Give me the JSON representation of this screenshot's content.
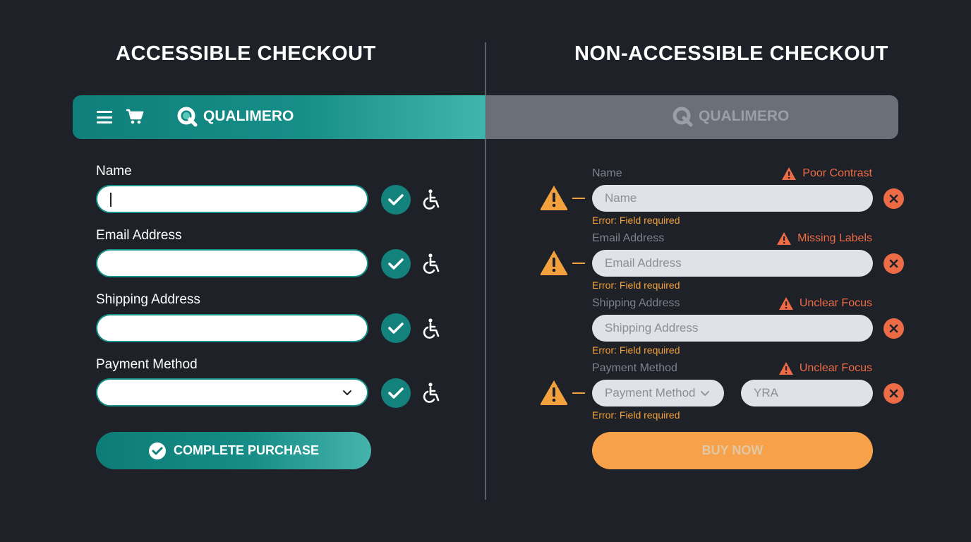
{
  "left_panel": {
    "title": "ACCESSIBLE CHECKOUT",
    "brand": "QUALIMERO",
    "fields": [
      {
        "label": "Name"
      },
      {
        "label": "Email Address"
      },
      {
        "label": "Shipping Address"
      },
      {
        "label": "Payment Method"
      }
    ],
    "submit_label": "COMPLETE PURCHASE"
  },
  "right_panel": {
    "title": "NON-ACCESSIBLE CHECKOUT",
    "brand": "QUALIMERO",
    "fields": [
      {
        "label": "Name",
        "placeholder": "Name",
        "issue": "Poor Contrast",
        "error": "Error: Field required"
      },
      {
        "label": "Email Address",
        "placeholder": "Email Address",
        "issue": "Missing Labels",
        "error": "Error: Field required"
      },
      {
        "label": "Shipping Address",
        "placeholder": "Shipping Address",
        "issue": "Unclear Focus",
        "error": "Error: Field required"
      },
      {
        "label": "Payment Method",
        "placeholder": "Payment Method",
        "extra_placeholder": "YRA",
        "issue": "Unclear Focus",
        "error": "Error: Field required"
      }
    ],
    "submit_label": "BUY NOW"
  },
  "colors": {
    "accent_teal": "#13827d",
    "warning_orange": "#f3a13c",
    "error_red": "#ed6b45",
    "background": "#1e2228"
  }
}
